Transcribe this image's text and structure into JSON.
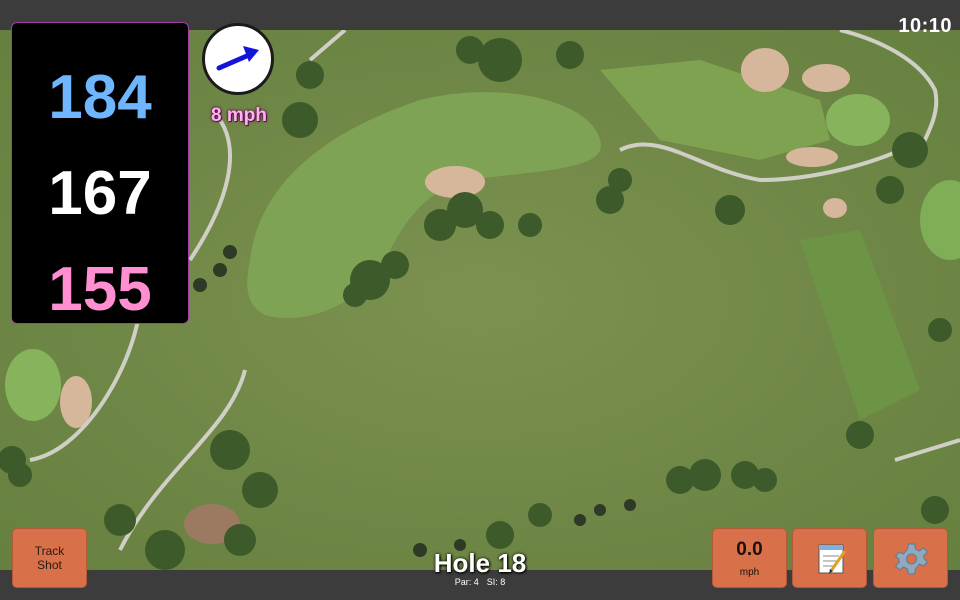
{
  "status_bar": {
    "time": "10:10"
  },
  "distances": {
    "back": "184",
    "middle": "167",
    "front": "155"
  },
  "wind": {
    "speed": "8 mph",
    "direction": "east-northeast",
    "icon": "wind-arrow-icon"
  },
  "track_shot": {
    "line1": "Track",
    "line2": "Shot"
  },
  "hole": {
    "title": "Hole 18",
    "par": "Par: 4",
    "stroke_index": "SI: 8"
  },
  "speed": {
    "value": "0.0",
    "unit": "mph"
  },
  "icons": {
    "notes": "notepad-icon",
    "settings": "gear-icon"
  },
  "colors": {
    "back": "#6fb6ff",
    "middle": "#ffffff",
    "front": "#ff8fd0",
    "button": "#d8714a",
    "panel_border": "#a43ea9"
  }
}
